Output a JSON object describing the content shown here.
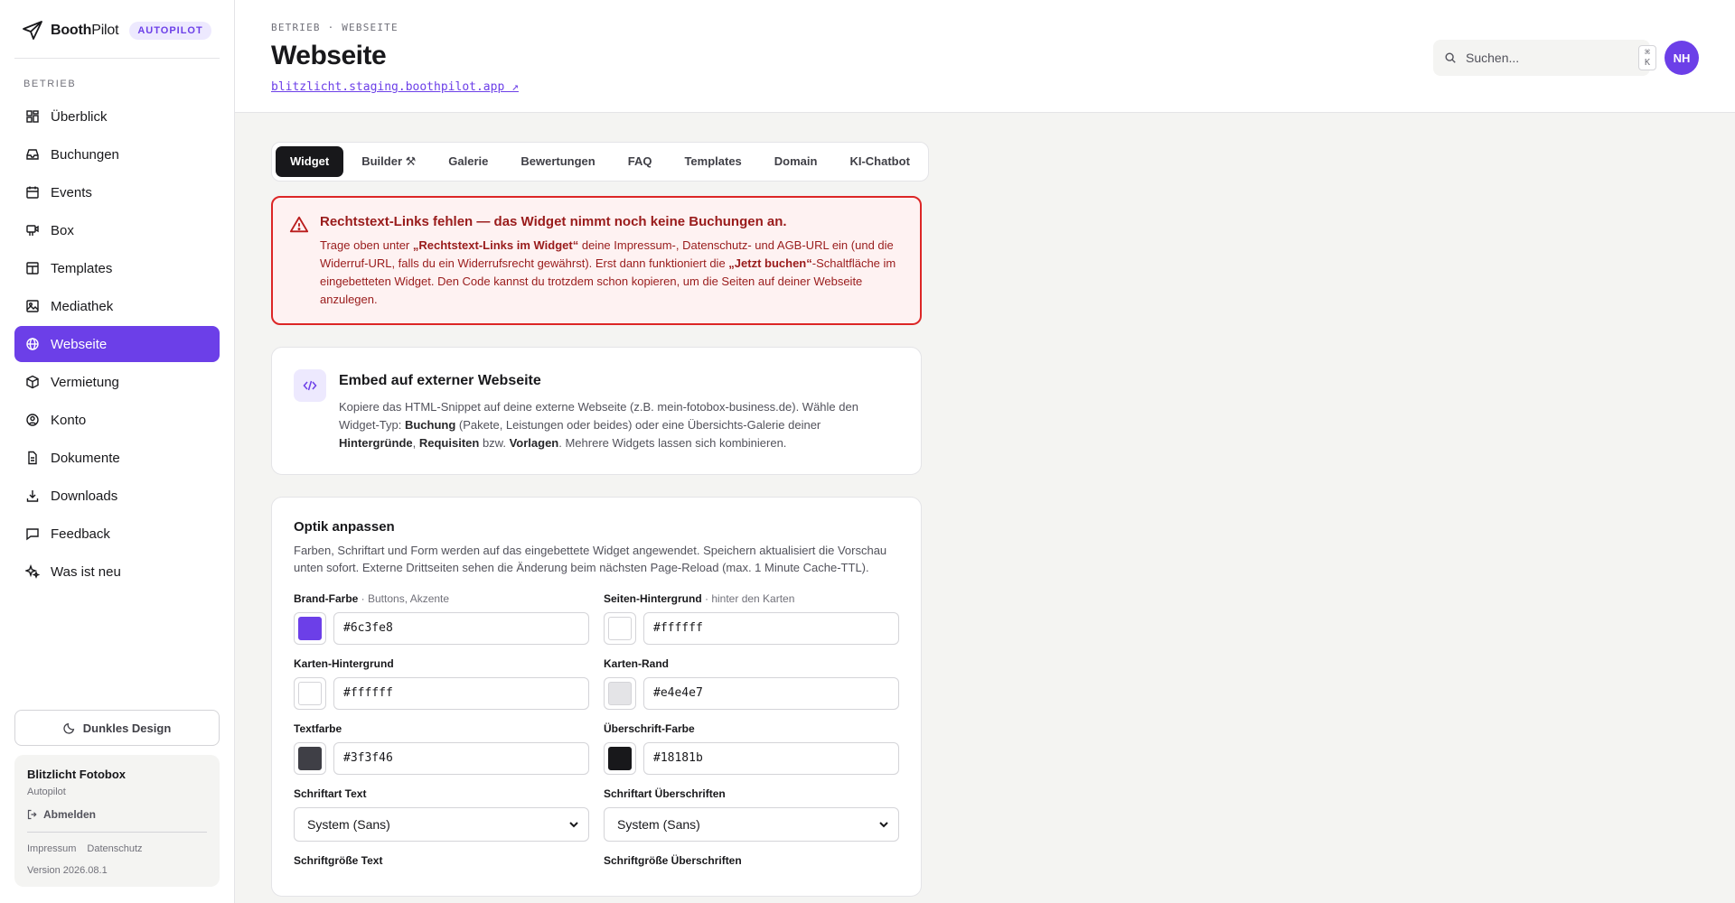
{
  "brand": {
    "name_bold": "Booth",
    "name_light": "Pilot",
    "badge": "AUTOPILOT"
  },
  "sidebar": {
    "section": "BETRIEB",
    "items": [
      {
        "label": "Überblick",
        "icon": "grid-icon",
        "active": false
      },
      {
        "label": "Buchungen",
        "icon": "inbox-icon",
        "active": false
      },
      {
        "label": "Events",
        "icon": "calendar-icon",
        "active": false
      },
      {
        "label": "Box",
        "icon": "box-camera-icon",
        "active": false
      },
      {
        "label": "Templates",
        "icon": "layout-icon",
        "active": false
      },
      {
        "label": "Mediathek",
        "icon": "image-icon",
        "active": false
      },
      {
        "label": "Webseite",
        "icon": "globe-icon",
        "active": true
      },
      {
        "label": "Vermietung",
        "icon": "package-icon",
        "active": false
      },
      {
        "label": "Konto",
        "icon": "user-circle-icon",
        "active": false
      },
      {
        "label": "Dokumente",
        "icon": "file-icon",
        "active": false
      },
      {
        "label": "Downloads",
        "icon": "download-icon",
        "active": false
      },
      {
        "label": "Feedback",
        "icon": "message-icon",
        "active": false
      },
      {
        "label": "Was ist neu",
        "icon": "sparkles-icon",
        "active": false
      }
    ],
    "theme_button": "Dunkles Design",
    "account": {
      "name": "Blitzlicht Fotobox",
      "role": "Autopilot",
      "logout": "Abmelden",
      "impressum": "Impressum",
      "datenschutz": "Datenschutz",
      "version": "Version 2026.08.1"
    }
  },
  "header": {
    "breadcrumb": "BETRIEB · WEBSEITE",
    "title": "Webseite",
    "site_link": "blitzlicht.staging.boothpilot.app ↗",
    "search_placeholder": "Suchen...",
    "search_shortcut": "⌘ K",
    "avatar": "NH"
  },
  "tabs": [
    {
      "label": "Widget",
      "active": true
    },
    {
      "label": "Builder ⚒",
      "active": false
    },
    {
      "label": "Galerie",
      "active": false
    },
    {
      "label": "Bewertungen",
      "active": false
    },
    {
      "label": "FAQ",
      "active": false
    },
    {
      "label": "Templates",
      "active": false
    },
    {
      "label": "Domain",
      "active": false
    },
    {
      "label": "KI-Chatbot",
      "active": false
    }
  ],
  "alert": {
    "title": "Rechtstext-Links fehlen — das Widget nimmt noch keine Buchungen an.",
    "t1": "Trage oben unter ",
    "b1": "„Rechtstext-Links im Widget“",
    "t2": " deine Impressum-, Datenschutz- und AGB-URL ein (und die Widerruf-URL, falls du ein Widerrufsrecht gewährst). Erst dann funktioniert die ",
    "b2": "„Jetzt buchen“",
    "t3": "-Schaltfläche im eingebetteten Widget. Den Code kannst du trotzdem schon kopieren, um die Seiten auf deiner Webseite anzulegen."
  },
  "embed": {
    "title": "Embed auf externer Webseite",
    "t1": "Kopiere das HTML-Snippet auf deine externe Webseite (z.B. mein-fotobox-business.de). Wähle den Widget-Typ: ",
    "b1": "Buchung",
    "t2": " (Pakete, Leistungen oder beides) oder eine Übersichts-Galerie deiner ",
    "b2": "Hintergründe",
    "t3": ", ",
    "b3": "Requisiten",
    "t4": " bzw. ",
    "b4": "Vorlagen",
    "t5": ". Mehrere Widgets lassen sich kombinieren."
  },
  "optik": {
    "title": "Optik anpassen",
    "text": "Farben, Schriftart und Form werden auf das eingebettete Widget angewendet. Speichern aktualisiert die Vorschau unten sofort. Externe Drittseiten sehen die Änderung beim nächsten Page-Reload (max. 1 Minute Cache-TTL).",
    "brand_label": "Brand-Farbe",
    "brand_hint": " · Buttons, Akzente",
    "brand_value": "#6c3fe8",
    "bg_label": "Seiten-Hintergrund",
    "bg_hint": " · hinter den Karten",
    "bg_value": "#ffffff",
    "card_bg_label": "Karten-Hintergrund",
    "card_bg_value": "#ffffff",
    "card_border_label": "Karten-Rand",
    "card_border_value": "#e4e4e7",
    "text_label": "Textfarbe",
    "text_value": "#3f3f46",
    "heading_label": "Überschrift-Farbe",
    "heading_value": "#18181b",
    "font_text_label": "Schriftart Text",
    "font_text_value": "System (Sans)",
    "font_heading_label": "Schriftart Überschriften",
    "font_heading_value": "System (Sans)",
    "size_text_label": "Schriftgröße Text",
    "size_heading_label": "Schriftgröße Überschriften"
  }
}
